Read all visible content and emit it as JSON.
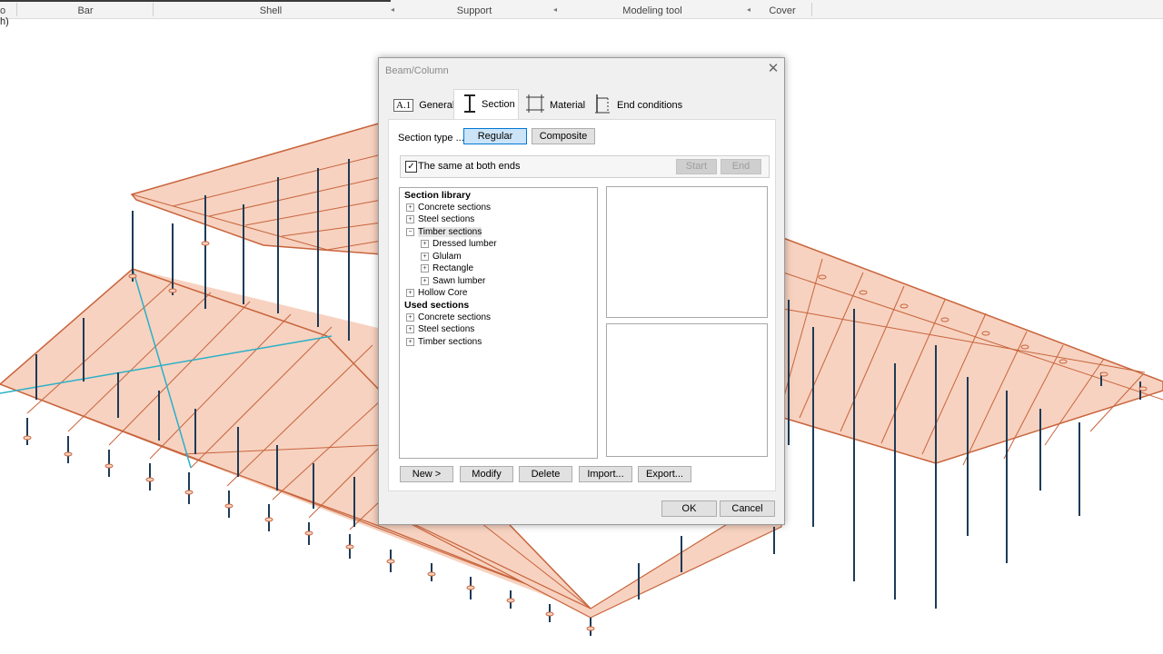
{
  "ribbon": {
    "left_fragment": "o",
    "groups": [
      "Bar",
      "Shell",
      "Support",
      "Modeling tool",
      "Cover"
    ]
  },
  "side_fragment": "h)",
  "dialog": {
    "title": "Beam/Column",
    "tabs": [
      {
        "label": "General",
        "icon": "A.1"
      },
      {
        "label": "Section",
        "icon": "I-beam-icon"
      },
      {
        "label": "Material",
        "icon": "material-grid-icon"
      },
      {
        "label": "End conditions",
        "icon": "end-conditions-icon"
      }
    ],
    "active_tab": "Section",
    "section_type_label": "Section type ....",
    "section_type_options": [
      "Regular",
      "Composite"
    ],
    "section_type_selected": "Regular",
    "same_ends_label": "The same at both ends",
    "same_ends_checked": true,
    "check_mark": "✓",
    "start_label": "Start",
    "end_label": "End",
    "tree": {
      "library_header": "Section library",
      "library": [
        {
          "label": "Concrete sections",
          "expander": "+"
        },
        {
          "label": "Steel sections",
          "expander": "+"
        },
        {
          "label": "Timber sections",
          "expander": "−",
          "selected": true,
          "children": [
            {
              "label": "Dressed lumber",
              "expander": "+"
            },
            {
              "label": "Glulam",
              "expander": "+"
            },
            {
              "label": "Rectangle",
              "expander": "+"
            },
            {
              "label": "Sawn lumber",
              "expander": "+"
            }
          ]
        },
        {
          "label": "Hollow Core",
          "expander": "+"
        }
      ],
      "used_header": "Used sections",
      "used": [
        {
          "label": "Concrete sections",
          "expander": "+"
        },
        {
          "label": "Steel sections",
          "expander": "+"
        },
        {
          "label": "Timber sections",
          "expander": "+"
        }
      ]
    },
    "actions": [
      "New >",
      "Modify",
      "Delete",
      "Import...",
      "Export..."
    ],
    "ok_label": "OK",
    "cancel_label": "Cancel",
    "close_glyph": "✕"
  },
  "colors": {
    "slab_fill": "#f7d2c0",
    "slab_edge": "#c8643c",
    "column": "#1d3b57",
    "bracing": "#2ab0c8",
    "selection_blue": "#0078d7"
  }
}
